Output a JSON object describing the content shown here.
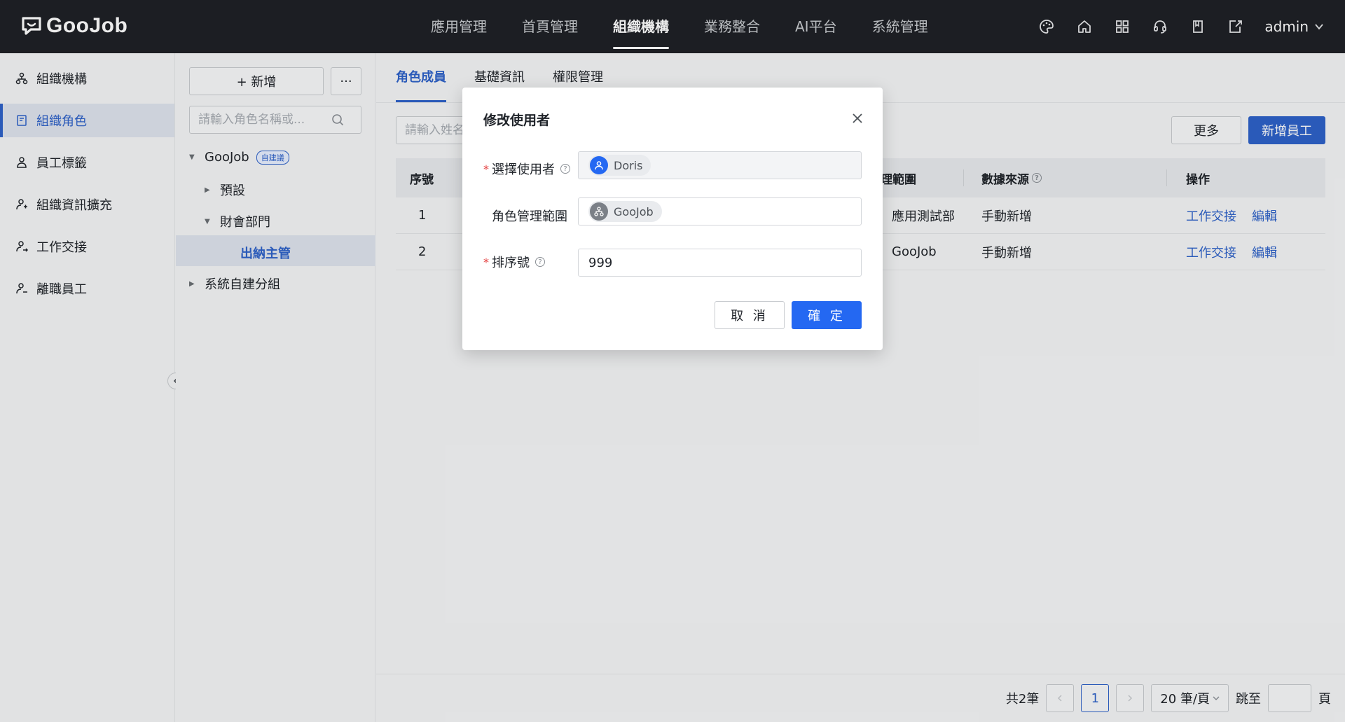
{
  "app": {
    "logo_text": "GooJob"
  },
  "topnav": {
    "items": [
      "應用管理",
      "首頁管理",
      "組織機構",
      "業務整合",
      "AI平台",
      "系統管理"
    ],
    "active_index": 2
  },
  "user": {
    "name": "admin"
  },
  "sidebar": {
    "items": [
      {
        "label": "組織機構",
        "icon": "org-icon"
      },
      {
        "label": "組織角色",
        "icon": "role-icon"
      },
      {
        "label": "員工標籤",
        "icon": "tag-icon"
      },
      {
        "label": "組織資訊擴充",
        "icon": "org-extend-icon"
      },
      {
        "label": "工作交接",
        "icon": "handover-icon"
      },
      {
        "label": "離職員工",
        "icon": "resigned-icon"
      }
    ],
    "active_index": 1
  },
  "tree": {
    "add_label": "+ 新增",
    "more_label": "···",
    "search_placeholder": "請輸入角色名稱或...",
    "root": {
      "label": "GooJob",
      "badge": "自建議"
    },
    "nodes": [
      {
        "label": "預設"
      },
      {
        "label": "財會部門"
      },
      {
        "label": "出納主管"
      },
      {
        "label": "系統自建分組"
      }
    ]
  },
  "main": {
    "tabs": [
      "角色成員",
      "基礎資訊",
      "權限管理"
    ],
    "active_tab": 0,
    "search_placeholder": "請輸入姓名",
    "more_button": "更多",
    "add_employee_button": "新增員工",
    "table": {
      "headers": [
        "序號",
        "理範圍",
        "數據來源",
        "操作"
      ],
      "rows": [
        {
          "index": "1",
          "scope": "應用測試部",
          "source": "手動新增",
          "action1": "工作交接",
          "action2": "編輯"
        },
        {
          "index": "2",
          "scope": "GooJob",
          "source": "手動新增",
          "action1": "工作交接",
          "action2": "編輯"
        }
      ]
    },
    "pagination": {
      "total": "共2筆",
      "current_page": "1",
      "page_size": "20 筆/頁",
      "jump_label": "跳至",
      "page_suffix": "頁"
    }
  },
  "modal": {
    "title": "修改使用者",
    "fields": {
      "user": {
        "label": "選擇使用者",
        "value": "Doris",
        "required": true
      },
      "scope": {
        "label": "角色管理範圍",
        "value": "GooJob",
        "required": false
      },
      "order": {
        "label": "排序號",
        "value": "999",
        "required": true
      }
    },
    "cancel_label": "取 消",
    "ok_label": "確 定"
  },
  "colors": {
    "primary": "#2e62c9",
    "confirm": "#2468f2",
    "topbar": "#1f2126",
    "required": "#e54545"
  }
}
